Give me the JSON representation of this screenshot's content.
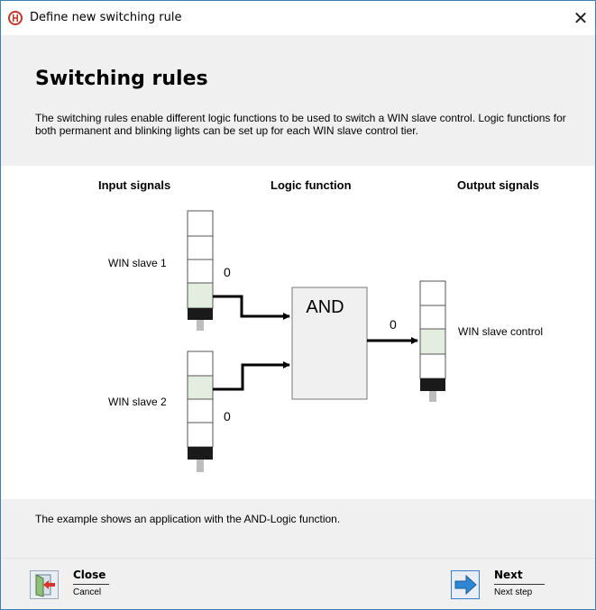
{
  "window": {
    "title": "Define new switching rule",
    "close_glyph": "✕"
  },
  "header": {
    "title": "Switching rules",
    "description": "The switching rules enable different logic functions to be used to switch a WIN slave control. Logic functions for both permanent and blinking lights can be set up for each WIN slave control tier."
  },
  "diagram": {
    "col_input": "Input signals",
    "col_logic": "Logic function",
    "col_output": "Output signals",
    "slave1_label": "WIN slave 1",
    "slave2_label": "WIN slave 2",
    "control_label": "WIN slave control",
    "slave1_signal": "0",
    "slave2_signal": "0",
    "output_signal": "0",
    "gate_label": "AND",
    "colors": {
      "tower_segment": "#ffffff",
      "tower_lit": "#e4eee0",
      "tower_base": "#1a1a1a",
      "gate_fill": "#f0f0f0"
    }
  },
  "info": {
    "text": "The example shows an application with the AND-Logic function."
  },
  "buttons": {
    "close": {
      "label": "Close",
      "sub": "Cancel",
      "icon": "close-door-icon"
    },
    "next": {
      "label": "Next",
      "sub": "Next step",
      "icon": "arrow-right-icon"
    }
  }
}
